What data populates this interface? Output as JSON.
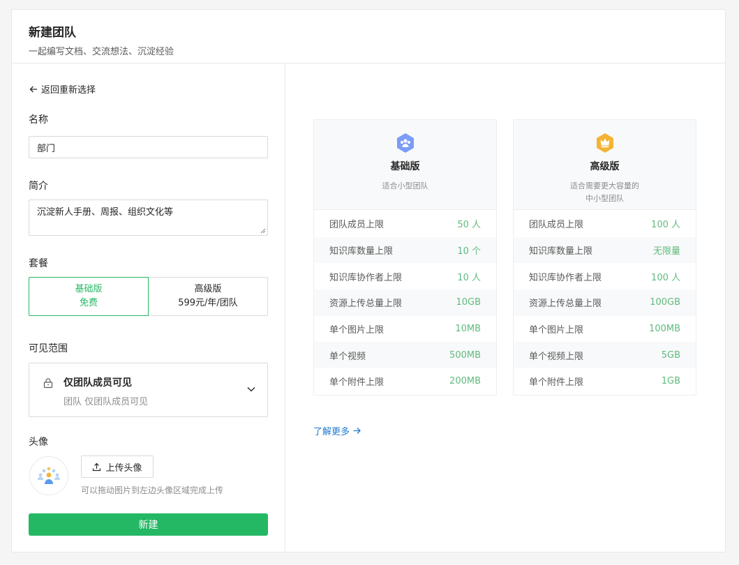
{
  "header": {
    "title": "新建团队",
    "subtitle": "一起编写文档、交流想法、沉淀经验"
  },
  "form": {
    "back_label": "返回重新选择",
    "name_label": "名称",
    "name_value": "部门",
    "intro_label": "简介",
    "intro_value": "沉淀新人手册、周报、组织文化等",
    "plan_label": "套餐",
    "plans": [
      {
        "name": "基础版",
        "price": "免费",
        "selected": true
      },
      {
        "name": "高级版",
        "price": "599元/年/团队",
        "selected": false
      }
    ],
    "visibility_label": "可见范围",
    "visibility_title": "仅团队成员可见",
    "visibility_desc": "团队 仅团队成员可见",
    "avatar_label": "头像",
    "upload_label": "上传头像",
    "upload_hint": "可以拖动图片到左边头像区域完成上传",
    "submit_label": "新建"
  },
  "tiers": [
    {
      "name": "基础版",
      "desc_lines": [
        "适合小型团队"
      ],
      "icon": "team-hexagon-icon",
      "icon_color": "#7b9cf7",
      "rows": [
        {
          "label": "团队成员上限",
          "value": "50 人"
        },
        {
          "label": "知识库数量上限",
          "value": "10 个"
        },
        {
          "label": "知识库协作者上限",
          "value": "10 人"
        },
        {
          "label": "资源上传总量上限",
          "value": "10GB"
        },
        {
          "label": "单个图片上限",
          "value": "10MB"
        },
        {
          "label": "单个视频",
          "value": "500MB"
        },
        {
          "label": "单个附件上限",
          "value": "200MB"
        }
      ]
    },
    {
      "name": "高级版",
      "desc_lines": [
        "适合需要更大容量的",
        "中小型团队"
      ],
      "icon": "crown-hexagon-icon",
      "icon_color": "#f5b335",
      "rows": [
        {
          "label": "团队成员上限",
          "value": "100 人"
        },
        {
          "label": "知识库数量上限",
          "value": "无限量"
        },
        {
          "label": "知识库协作者上限",
          "value": "100 人"
        },
        {
          "label": "资源上传总量上限",
          "value": "100GB"
        },
        {
          "label": "单个图片上限",
          "value": "100MB"
        },
        {
          "label": "单个视频上限",
          "value": "5GB"
        },
        {
          "label": "单个附件上限",
          "value": "1GB"
        }
      ]
    }
  ],
  "learn_more": "了解更多",
  "colors": {
    "accent": "#25b864",
    "value_green": "#5fba7d",
    "link": "#1f7ad1"
  }
}
